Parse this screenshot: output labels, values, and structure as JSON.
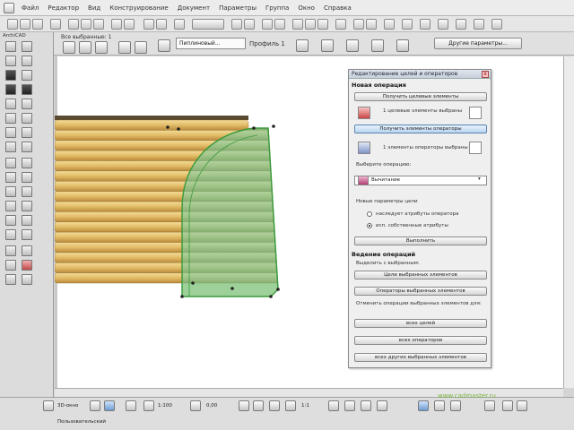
{
  "menubar": {
    "items": [
      "Файл",
      "Редактор",
      "Вид",
      "Конструирование",
      "Документ",
      "Параметры",
      "Группа",
      "Окно",
      "Справка"
    ]
  },
  "infobox": {
    "label_main": "Все выбранные: 1",
    "profile_dropdown": "Пиплиновый...",
    "profile_label": "Профиль 1",
    "settings_button": "Другие параметры..."
  },
  "toolbox": {
    "title": "ArchiCAD"
  },
  "panel": {
    "title": "Редактирование целей и операторов",
    "close": "x",
    "section_new": "Новая операция",
    "btn_get_targets": "Получить целевые элементы",
    "targets_text": "1 целевые элементы выбраны",
    "btn_get_operators": "Получить элементы операторы",
    "operators_text": "1 элементы операторы выбраны",
    "operation_label": "Выберите операцию:",
    "operation_value": "Вычитание",
    "options_label": "Новые параметры цели",
    "radio_inherit": "наследует атрибуты оператора",
    "radio_own": "исп. собственные атрибуты",
    "btn_execute": "Выполнить",
    "section_manage": "Ведение операций",
    "sub_select": "Выделить с выбранным:",
    "btn_all_targets": "Цели выбранных элементов",
    "btn_all_operators": "Операторы выбранных элементов",
    "cancel_text": "Отменить операции выбранных элементов для:",
    "btn_all_ops": "всех целей",
    "btn_all_operators2": "всех операторов",
    "btn_all_other": "всех других выбранных элементов"
  },
  "bottombar": {
    "view_label": "3D-окно",
    "coord1": "1:100",
    "coord2": "0,00",
    "coord3": "1:1",
    "status": "Пользовательский",
    "watermark": "www.cadmaster.ru"
  },
  "colors": {
    "plank_light": "#e8c777",
    "plank_dark": "#c99a3f",
    "shape_fill": "#8ccb8a",
    "shape_stroke": "#3a9a3a",
    "accent": "#6b94c2"
  }
}
